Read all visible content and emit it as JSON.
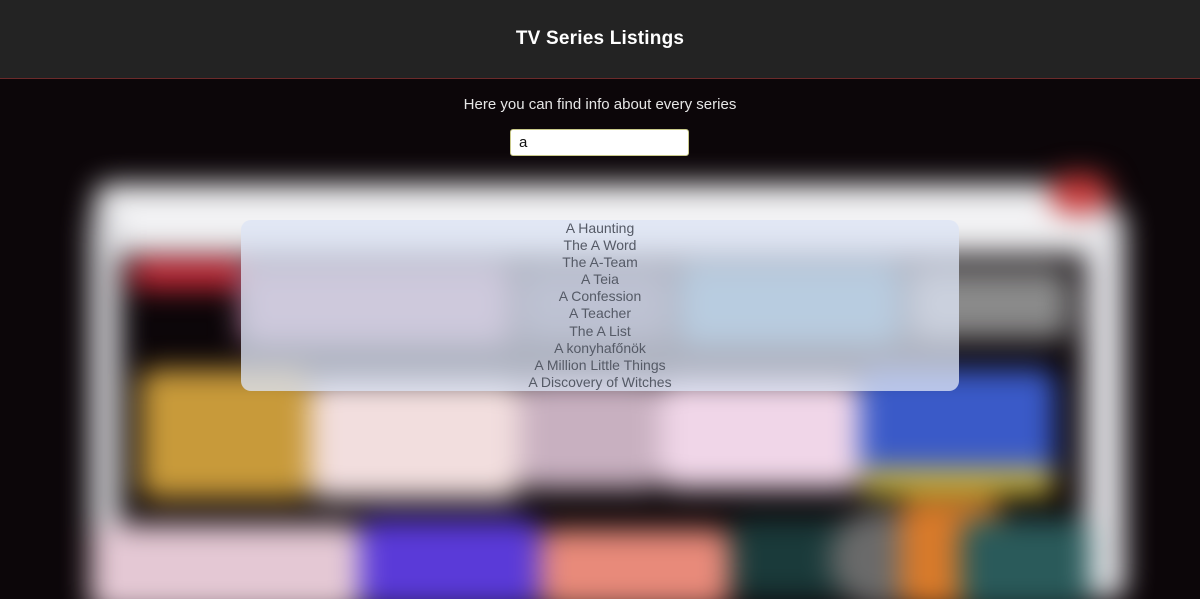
{
  "header": {
    "title": "TV Series Listings"
  },
  "main": {
    "subtitle": "Here you can find info about every series",
    "search": {
      "value": "a",
      "placeholder": ""
    },
    "results": [
      "A Haunting",
      "The A Word",
      "The A-Team",
      "A Teia",
      "A Confession",
      "A Teacher",
      "The A List",
      "A konyhafőnök",
      "A Million Little Things",
      "A Discovery of Witches"
    ]
  },
  "colors": {
    "header_bg": "#232323",
    "header_border": "#6b2a2a",
    "page_bg": "#0b0507",
    "results_bg": "#dce4f5",
    "result_text": "#555a66"
  }
}
